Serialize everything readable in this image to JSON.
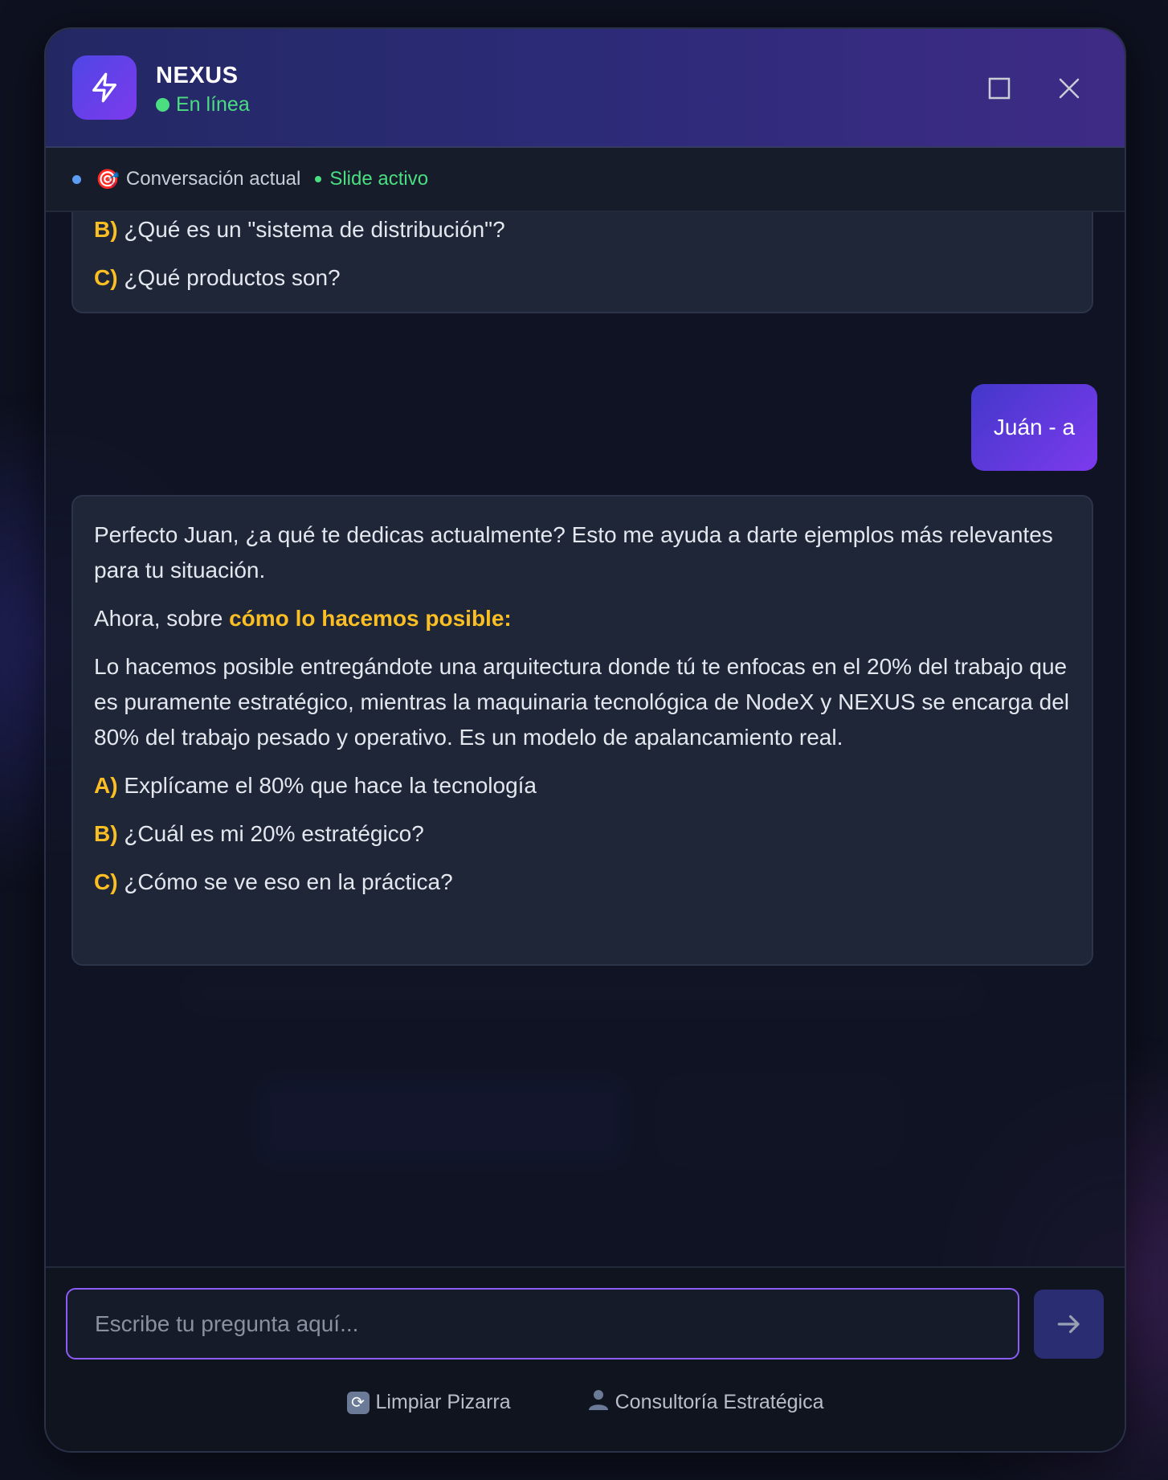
{
  "app": {
    "name": "NEXUS",
    "status": "En línea"
  },
  "context_bar": {
    "label": "Conversación actual",
    "icon": "target-icon",
    "active_label": "Slide activo"
  },
  "messages": [
    {
      "role": "assistant",
      "options": [
        {
          "letter": "B)",
          "text": "¿Qué es un \"sistema de distribución\"?"
        },
        {
          "letter": "C)",
          "text": "¿Qué productos son?"
        }
      ]
    },
    {
      "role": "user",
      "text": "Juán - a"
    },
    {
      "role": "assistant",
      "paragraph1": "Perfecto Juan, ¿a qué te dedicas actualmente? Esto me ayuda a darte ejemplos más relevantes para tu situación.",
      "paragraph2_prefix": "Ahora, sobre ",
      "paragraph2_highlight": "cómo lo hacemos posible:",
      "paragraph3": "Lo hacemos posible entregándote una arquitectura donde tú te enfocas en el 20% del trabajo que es puramente estratégico, mientras la maquinaria tecnológica de NodeX y NEXUS se encarga del 80% del trabajo pesado y operativo. Es un modelo de apalancamiento real.",
      "options": [
        {
          "letter": "A)",
          "text": "Explícame el 80% que hace la tecnología"
        },
        {
          "letter": "B)",
          "text": "¿Cuál es mi 20% estratégico?"
        },
        {
          "letter": "C)",
          "text": "¿Cómo se ve eso en la práctica?"
        }
      ]
    }
  ],
  "input": {
    "placeholder": "Escribe tu pregunta aquí...",
    "value": ""
  },
  "footer": {
    "clear_label": "Limpiar Pizarra",
    "consult_label": "Consultoría Estratégica"
  },
  "colors": {
    "accent": "#7c3aed",
    "online": "#4ade80",
    "option_letter": "#fbbf24"
  }
}
